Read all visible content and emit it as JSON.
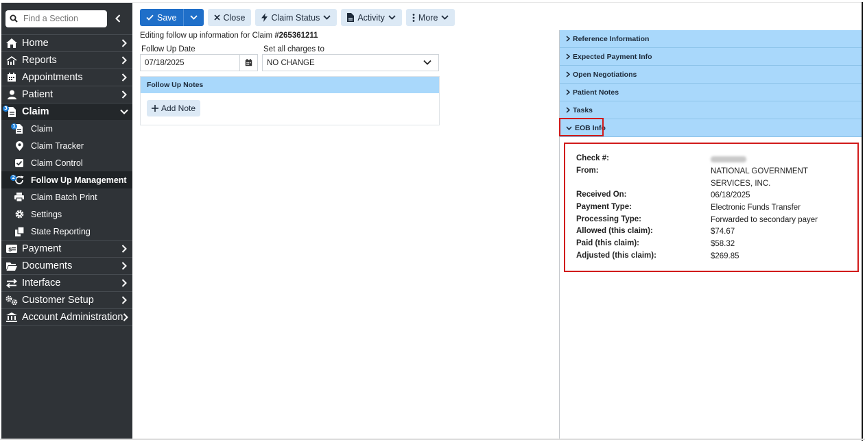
{
  "sidebar": {
    "search_placeholder": "Find a Section",
    "items": [
      {
        "label": "Home"
      },
      {
        "label": "Reports"
      },
      {
        "label": "Appointments"
      },
      {
        "label": "Patient"
      },
      {
        "label": "Claim",
        "badge": "3"
      },
      {
        "label": "Payment"
      },
      {
        "label": "Documents"
      },
      {
        "label": "Interface"
      },
      {
        "label": "Customer Setup"
      },
      {
        "label": "Account Administration"
      }
    ],
    "claim_sub": [
      {
        "label": "Claim",
        "badge": "1"
      },
      {
        "label": "Claim Tracker"
      },
      {
        "label": "Claim Control"
      },
      {
        "label": "Follow Up Management",
        "badge": "2"
      },
      {
        "label": "Claim Batch Print"
      },
      {
        "label": "Settings"
      },
      {
        "label": "State Reporting"
      }
    ]
  },
  "toolbar": {
    "save": "Save",
    "close": "Close",
    "claim_status": "Claim Status",
    "activity": "Activity",
    "more": "More"
  },
  "editing": {
    "prefix": "Editing follow up information for Claim ",
    "claim_no": "#265361211"
  },
  "form": {
    "follow_up_date_label": "Follow Up Date",
    "follow_up_date": "07/18/2025",
    "set_all_label": "Set all charges to",
    "set_all_value": "NO CHANGE"
  },
  "notes": {
    "title": "Follow Up Notes",
    "add_note": "Add Note"
  },
  "accordion": [
    {
      "label": "Reference Information"
    },
    {
      "label": "Expected Payment Info"
    },
    {
      "label": "Open Negotiations"
    },
    {
      "label": "Patient Notes"
    },
    {
      "label": "Tasks"
    },
    {
      "label": "EOB Info"
    }
  ],
  "eob": {
    "check_label": "Check #:",
    "from_label": "From:",
    "from_value": "NATIONAL GOVERNMENT SERVICES, INC.",
    "received_label": "Received On:",
    "received_value": "06/18/2025",
    "payment_type_label": "Payment Type:",
    "payment_type_value": "Electronic Funds Transfer",
    "processing_type_label": "Processing Type:",
    "processing_type_value": "Forwarded to secondary payer",
    "allowed_label": "Allowed (this claim):",
    "allowed_value": "$74.67",
    "paid_label": "Paid (this claim):",
    "paid_value": "$58.32",
    "adjusted_label": "Adjusted (this claim):",
    "adjusted_value": "$269.85"
  },
  "colors": {
    "sidebar_bg": "#2f3337",
    "primary": "#1f6fc9",
    "accordion_bg": "#a9d8fb",
    "highlight_red": "#d11a1a"
  }
}
